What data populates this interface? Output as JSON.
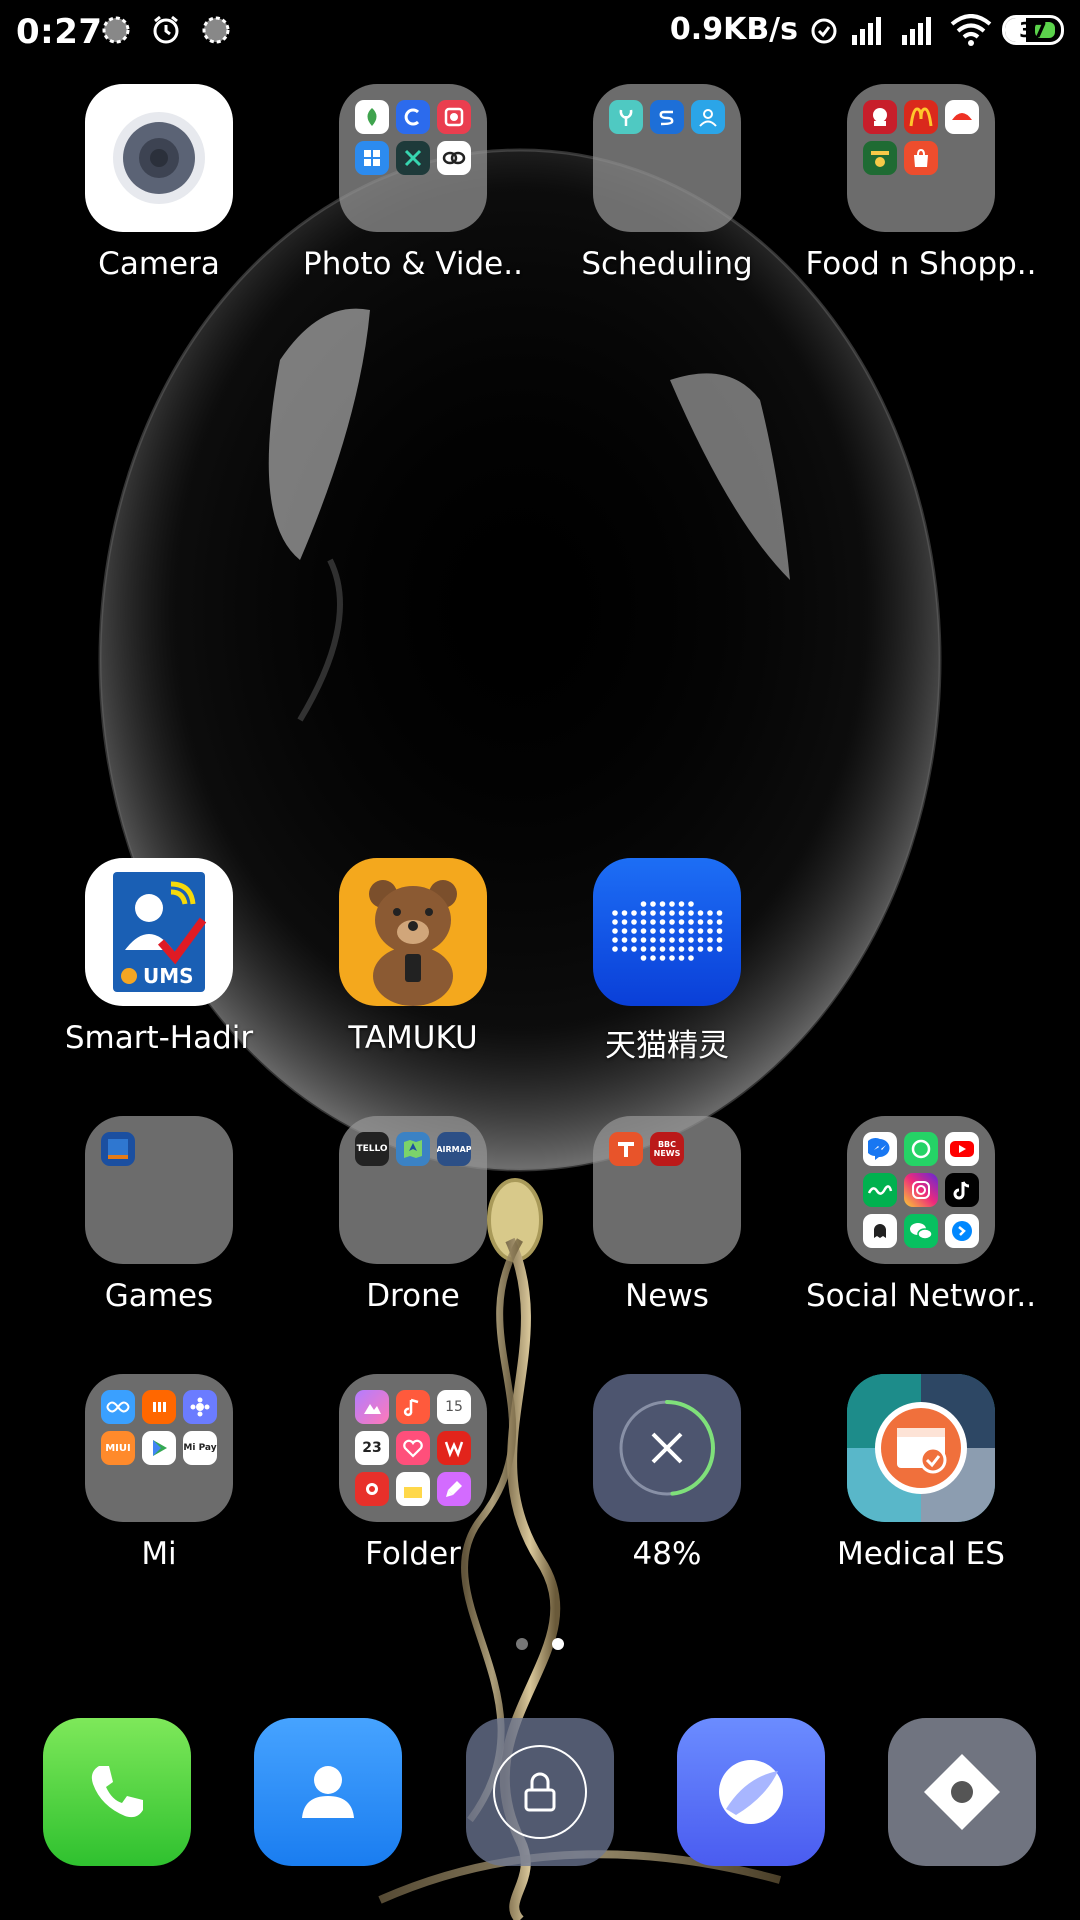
{
  "status_bar": {
    "time": "0:27",
    "network_speed": "0.9KB/s",
    "battery_level": "37"
  },
  "apps": {
    "camera": {
      "label": "Camera"
    },
    "photo_video": {
      "label": "Photo & Vide.."
    },
    "scheduling": {
      "label": "Scheduling"
    },
    "food_shopping": {
      "label": "Food n Shopp.."
    },
    "smart_hadir": {
      "label": "Smart-Hadir",
      "badge_text": "UMS"
    },
    "tamuku": {
      "label": "TAMUKU"
    },
    "tmall_genie": {
      "label": "天猫精灵"
    },
    "games": {
      "label": "Games"
    },
    "drone": {
      "label": "Drone",
      "mini_labels": [
        "TELLO",
        "AIRMAP"
      ]
    },
    "news": {
      "label": "News",
      "mini_labels": [
        "BBC NEWS"
      ]
    },
    "social_network": {
      "label": "Social Networ.."
    },
    "mi": {
      "label": "Mi",
      "mini_labels": [
        "MIUI",
        "Mi Pay"
      ]
    },
    "folder": {
      "label": "Folder",
      "mini_labels": [
        "15",
        "23"
      ]
    },
    "cleaner": {
      "label": "48%",
      "progress_percent": 48
    },
    "medical_es": {
      "label": "Medical ES"
    }
  },
  "page_indicator": {
    "count": 2,
    "active": 2
  },
  "dock": [
    "phone",
    "contacts",
    "lock",
    "browser",
    "settings"
  ]
}
